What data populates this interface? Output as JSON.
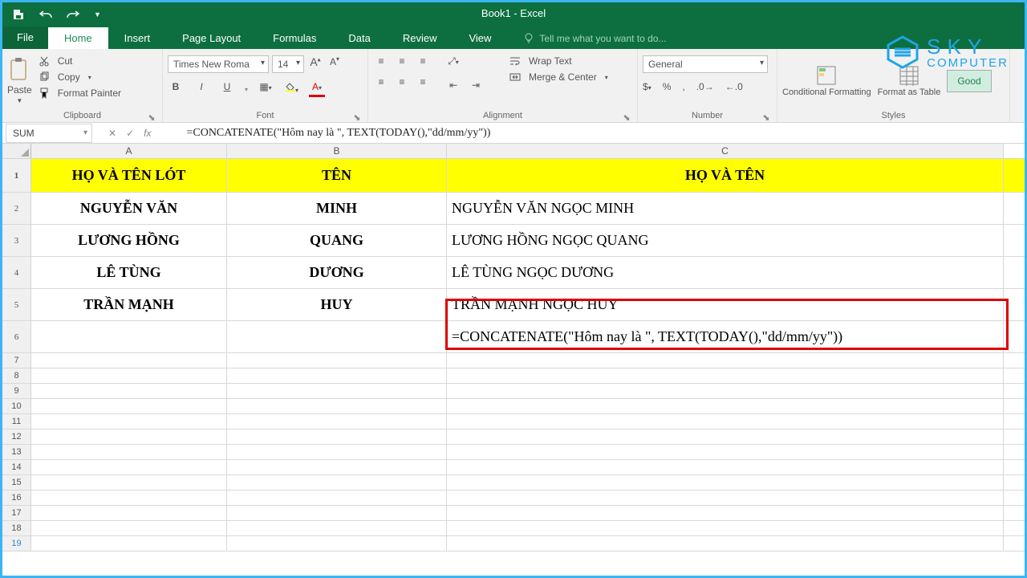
{
  "title": "Book1 - Excel",
  "tabs": {
    "file": "File",
    "home": "Home",
    "insert": "Insert",
    "pagelayout": "Page Layout",
    "formulas": "Formulas",
    "data": "Data",
    "review": "Review",
    "view": "View"
  },
  "tell_me": "Tell me what you want to do...",
  "clipboard": {
    "paste": "Paste",
    "cut": "Cut",
    "copy": "Copy",
    "format_painter": "Format Painter",
    "label": "Clipboard"
  },
  "font": {
    "name": "Times New Roma",
    "size": "14",
    "label": "Font"
  },
  "alignment": {
    "wrap": "Wrap Text",
    "merge": "Merge & Center",
    "label": "Alignment"
  },
  "number": {
    "format": "General",
    "label": "Number"
  },
  "styles": {
    "cond": "Conditional Formatting",
    "fat": "Format as Table",
    "good": "Good",
    "label": "Styles"
  },
  "formula_bar": {
    "name_box": "SUM",
    "value": "=CONCATENATE(\"Hôm nay là \", TEXT(TODAY(),\"dd/mm/yy\"))"
  },
  "cols": {
    "a": "A",
    "b": "B",
    "c": "C"
  },
  "headers": {
    "a": "HỌ VÀ TÊN LÓT",
    "b": "TÊN",
    "c": "HỌ VÀ TÊN"
  },
  "rows": [
    {
      "a": "NGUYỄN VĂN",
      "b": "MINH",
      "c": "NGUYỄN VĂN  NGỌC MINH"
    },
    {
      "a": "LƯƠNG HỒNG",
      "b": "QUANG",
      "c": "LƯƠNG HỒNG NGỌC QUANG"
    },
    {
      "a": "LÊ TÙNG",
      "b": "DƯƠNG",
      "c": "LÊ TÙNG NGỌC DƯƠNG"
    },
    {
      "a": "TRẦN MẠNH",
      "b": "HUY",
      "c": "TRẦN MẠNH NGỌC HUY"
    }
  ],
  "formula_cell": "=CONCATENATE(\"Hôm nay là \", TEXT(TODAY(),\"dd/mm/yy\"))",
  "watermark": {
    "l1": "SKY",
    "l2": "COMPUTER"
  }
}
